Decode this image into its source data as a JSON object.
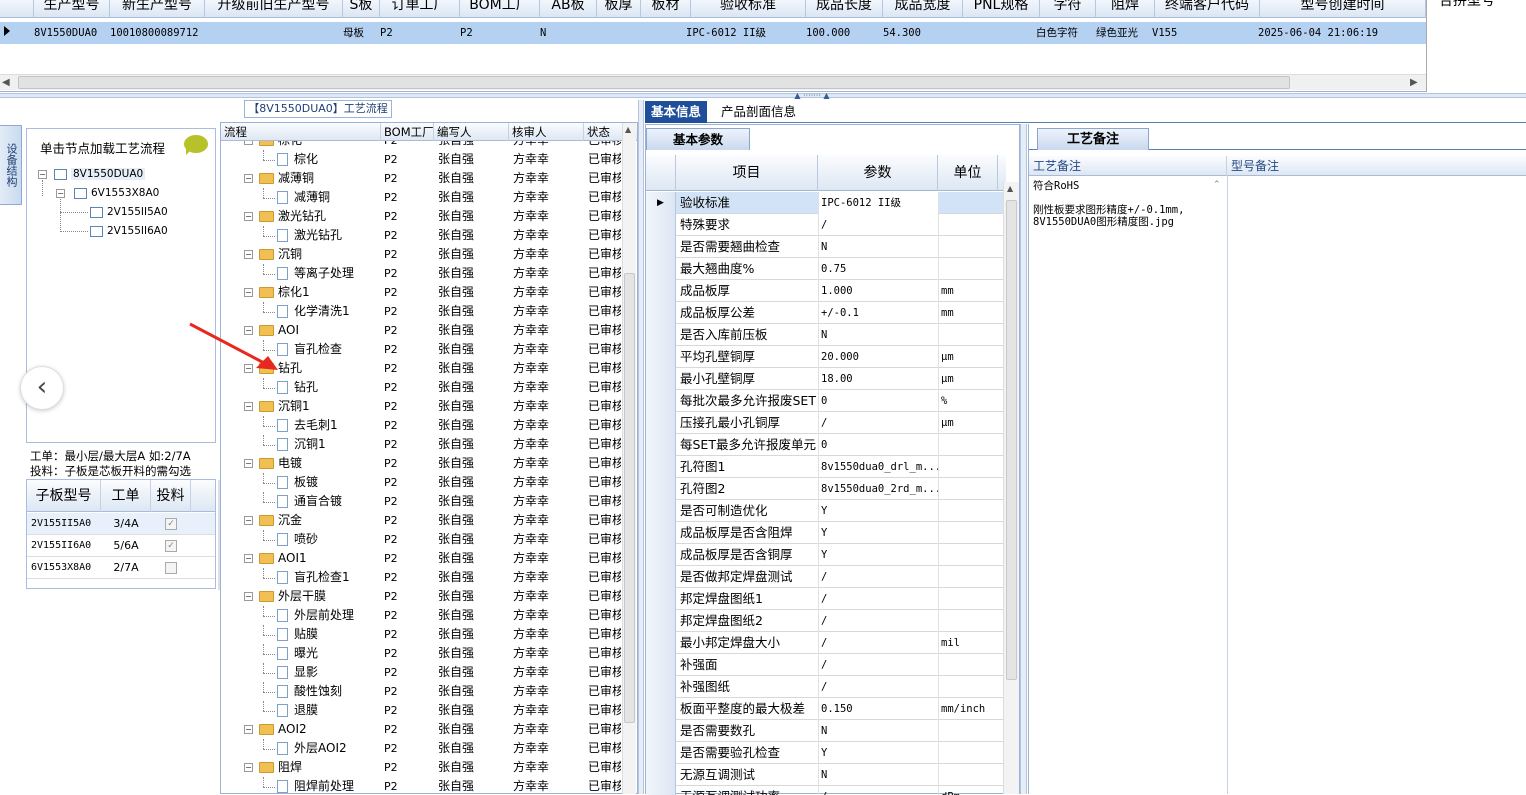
{
  "top_grid": {
    "headers": [
      "生产型号",
      "新生产型号",
      "升级前旧生产型号",
      "S板",
      "订单工厂",
      "BOM工厂",
      "AB板",
      "板厚",
      "板材",
      "验收标准",
      "成品长度",
      "成品宽度",
      "PNL规格",
      "字符",
      "阻焊",
      "终端客户代码",
      "型号创建时间"
    ],
    "row": [
      "8V1550DUA0",
      "10010800089712",
      "",
      "母板",
      "P2",
      "P2",
      "N",
      "",
      "",
      "IPC-6012 II级",
      "100.000",
      "54.300",
      "",
      "白色字符",
      "绿色亚光",
      "V155",
      "2025-06-04 21:06:19"
    ],
    "right_header": "合拼型号"
  },
  "left_panel": {
    "side_tab": "设备结构",
    "load_button": "单击节点加载工艺流程",
    "tree": [
      {
        "label": "8V1550DUA0",
        "level": 0
      },
      {
        "label": "6V1553X8A0",
        "level": 1
      },
      {
        "label": "2V155II5A0",
        "level": 2
      },
      {
        "label": "2V155II6A0",
        "level": 2
      }
    ],
    "note_line1": "工单：最小层/最大层A 如:2/7A",
    "note_line2": "投料：子板是芯板开料的需勾选",
    "sub_headers": [
      "子板型号",
      "工单",
      "投料"
    ],
    "sub_rows": [
      {
        "model": "2V155II5A0",
        "order": "3/4A",
        "checked": true
      },
      {
        "model": "2V155II6A0",
        "order": "5/6A",
        "checked": true
      },
      {
        "model": "6V1553X8A0",
        "order": "2/7A",
        "checked": false
      }
    ],
    "back_glyph": "‹"
  },
  "process": {
    "title": "【8V1550DUA0】工艺流程",
    "headers": [
      "流程",
      "BOM工厂",
      "编写人",
      "核审人",
      "状态"
    ],
    "rows": [
      {
        "name": "棕化",
        "type": "folder"
      },
      {
        "name": "棕化",
        "type": "file"
      },
      {
        "name": "减薄铜",
        "type": "folder"
      },
      {
        "name": "减薄铜",
        "type": "file"
      },
      {
        "name": "激光钻孔",
        "type": "folder"
      },
      {
        "name": "激光钻孔",
        "type": "file"
      },
      {
        "name": "沉铜",
        "type": "folder"
      },
      {
        "name": "等离子处理",
        "type": "file"
      },
      {
        "name": "棕化1",
        "type": "folder"
      },
      {
        "name": "化学清洗1",
        "type": "file"
      },
      {
        "name": "AOI",
        "type": "folder"
      },
      {
        "name": "盲孔检查",
        "type": "file"
      },
      {
        "name": "钻孔",
        "type": "folder"
      },
      {
        "name": "钻孔",
        "type": "file"
      },
      {
        "name": "沉铜1",
        "type": "folder"
      },
      {
        "name": "去毛刺1",
        "type": "file"
      },
      {
        "name": "沉铜1",
        "type": "file"
      },
      {
        "name": "电镀",
        "type": "folder"
      },
      {
        "name": "板镀",
        "type": "file"
      },
      {
        "name": "通盲合镀",
        "type": "file"
      },
      {
        "name": "沉金",
        "type": "folder"
      },
      {
        "name": "喷砂",
        "type": "file"
      },
      {
        "name": "AOI1",
        "type": "folder"
      },
      {
        "name": "盲孔检查1",
        "type": "file"
      },
      {
        "name": "外层干膜",
        "type": "folder"
      },
      {
        "name": "外层前处理",
        "type": "file"
      },
      {
        "name": "贴膜",
        "type": "file"
      },
      {
        "name": "曝光",
        "type": "file"
      },
      {
        "name": "显影",
        "type": "file"
      },
      {
        "name": "酸性蚀刻",
        "type": "file"
      },
      {
        "name": "退膜",
        "type": "file"
      },
      {
        "name": "AOI2",
        "type": "folder"
      },
      {
        "name": "外层AOI2",
        "type": "file"
      },
      {
        "name": "阻焊",
        "type": "folder"
      },
      {
        "name": "阻焊前处理",
        "type": "file"
      }
    ],
    "bom": "P2",
    "writer": "张自强",
    "reviewer": "方幸幸",
    "status": "已审核"
  },
  "right_tabs": [
    "基本信息",
    "产品剖面信息"
  ],
  "basic": {
    "tab": "基本参数",
    "headers": [
      "项目",
      "参数",
      "单位"
    ],
    "rows": [
      [
        "验收标准",
        "IPC-6012 II级",
        ""
      ],
      [
        "特殊要求",
        "/",
        ""
      ],
      [
        "是否需要翘曲检查",
        "N",
        ""
      ],
      [
        "最大翘曲度%",
        "0.75",
        ""
      ],
      [
        "成品板厚",
        "1.000",
        "mm"
      ],
      [
        "成品板厚公差",
        "+/-0.1",
        "mm"
      ],
      [
        "是否入库前压板",
        "N",
        ""
      ],
      [
        "平均孔壁铜厚",
        "20.000",
        "μm"
      ],
      [
        "最小孔壁铜厚",
        "18.00",
        "μm"
      ],
      [
        "每批次最多允许报废SET",
        "0",
        "%"
      ],
      [
        "压接孔最小孔铜厚",
        "/",
        "μm"
      ],
      [
        "每SET最多允许报废单元",
        "0",
        ""
      ],
      [
        "孔符图1",
        "8v1550dua0_drl_m...",
        ""
      ],
      [
        "孔符图2",
        "8v1550dua0_2rd_m...",
        ""
      ],
      [
        "是否可制造优化",
        "Y",
        ""
      ],
      [
        "成品板厚是否含阻焊",
        "Y",
        ""
      ],
      [
        "成品板厚是否含铜厚",
        "Y",
        ""
      ],
      [
        "是否做邦定焊盘测试",
        "/",
        ""
      ],
      [
        "邦定焊盘图纸1",
        "/",
        ""
      ],
      [
        "邦定焊盘图纸2",
        "/",
        ""
      ],
      [
        "最小邦定焊盘大小",
        "/",
        "mil"
      ],
      [
        "补强面",
        "/",
        ""
      ],
      [
        "补强图纸",
        "/",
        ""
      ],
      [
        "板面平整度的最大极差",
        "0.150",
        "mm/inch"
      ],
      [
        "是否需要数孔",
        "N",
        ""
      ],
      [
        "是否需要验孔检查",
        "Y",
        ""
      ],
      [
        "无源互调测试",
        "N",
        ""
      ],
      [
        "无源互调测试功率",
        "/",
        "dBm"
      ]
    ]
  },
  "remarks": {
    "tab": "工艺备注",
    "col1": "工艺备注",
    "col2": "型号备注",
    "text": "符合RoHS\n\n刚性板要求图形精度+/-0.1mm,\n8V1550DUA0图形精度图.jpg"
  },
  "colors": {
    "selected_row": "#b5d1f2",
    "folder": "#f2c052",
    "accent": "#1f4f9a",
    "arrow": "#e8281e"
  }
}
